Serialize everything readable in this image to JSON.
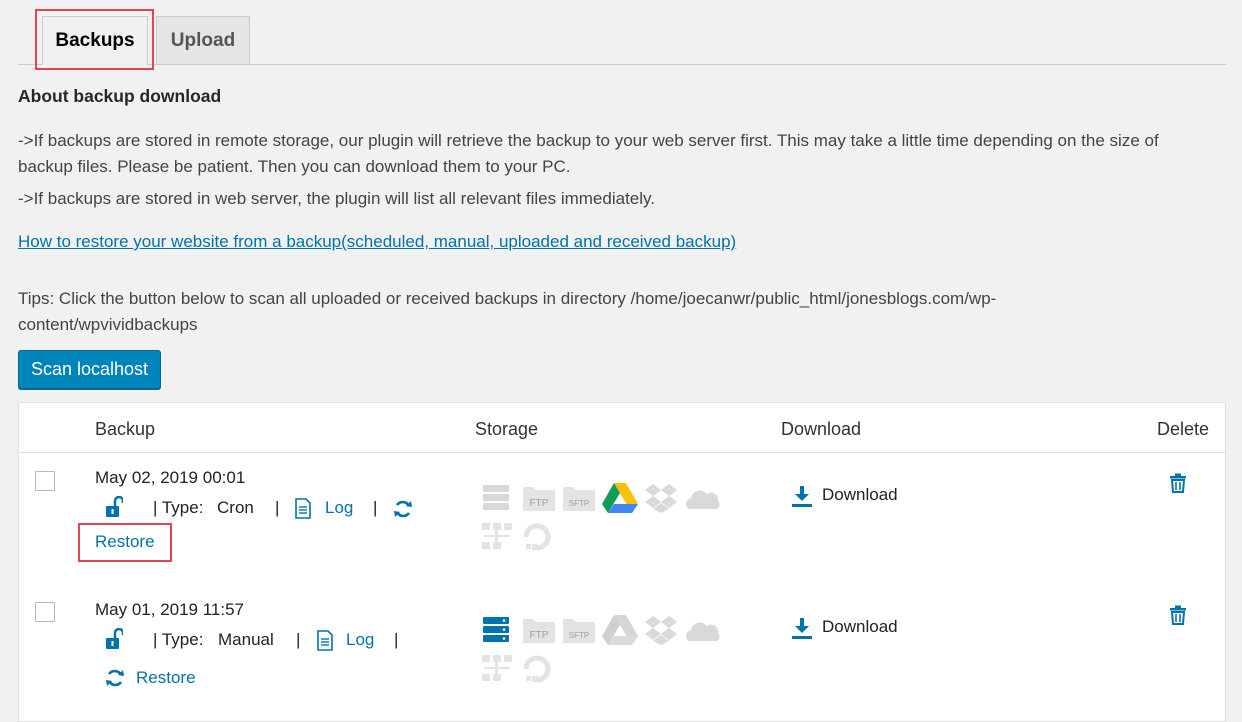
{
  "tabs": [
    {
      "label": "Backups",
      "active": true
    },
    {
      "label": "Upload",
      "active": false
    }
  ],
  "about": {
    "heading": "About backup download",
    "line1": "->If backups are stored in remote storage, our plugin will retrieve the backup to your web server first. This may take a little time depending on the size of",
    "line1b": "backup files. Please be patient. Then you can download them to your PC.",
    "line2": "->If backups are stored in web server, the plugin will list all relevant files immediately.",
    "restore_link": "How to restore your website from a backup(scheduled, manual, uploaded and received backup)",
    "tips1": "Tips: Click the button below to scan all uploaded or received backups in directory /home/joecanwr/public_html/jonesblogs.com/wp-",
    "tips2": "content/wpvividbackups"
  },
  "scan_button": "Scan localhost",
  "table": {
    "headers": {
      "backup": "Backup",
      "storage": "Storage",
      "download": "Download",
      "delete": "Delete"
    },
    "rows": [
      {
        "date": "May 02, 2019 00:01",
        "type_label": "| Type:",
        "type": "Cron",
        "log": "Log",
        "restore": "Restore",
        "download": "Download"
      },
      {
        "date": "May 01, 2019 11:57",
        "type_label": "| Type:",
        "type": "Manual",
        "log": "Log",
        "restore": "Restore",
        "download": "Download"
      }
    ]
  },
  "storage_labels": {
    "ftp": "FTP",
    "sftp": "SFTP"
  },
  "colors": {
    "accent": "#0073aa",
    "button": "#0085ba",
    "highlight": "#e0474c",
    "inactive_icon": "#d9d9d9"
  }
}
